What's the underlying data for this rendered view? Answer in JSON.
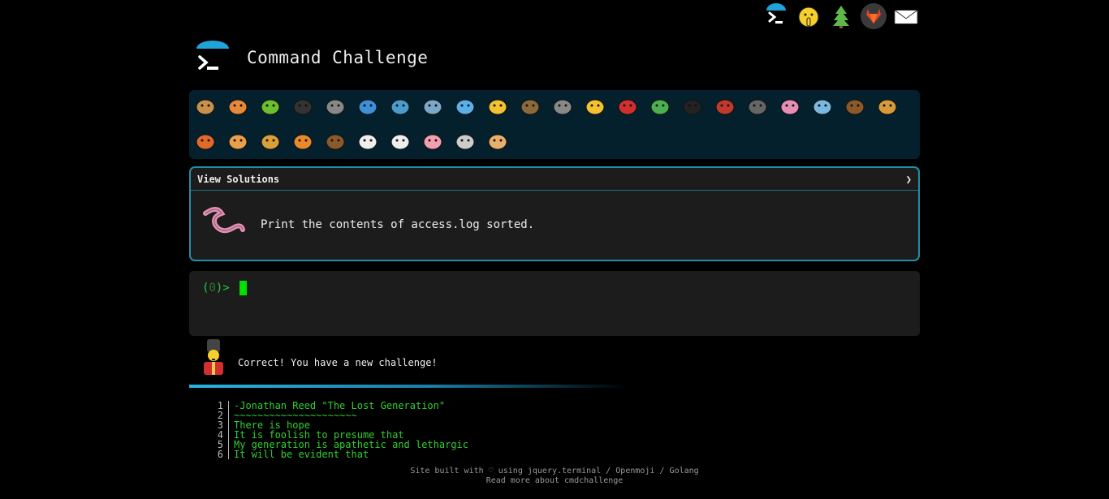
{
  "header": {
    "title": "Command Challenge"
  },
  "top_icons": [
    "terminal-icon",
    "shushing-face-icon",
    "tree-icon",
    "gitlab-icon",
    "envelope-icon"
  ],
  "animals": [
    "snail",
    "butterfly",
    "caterpillar",
    "ant",
    "web",
    "whale",
    "shark",
    "dolphin",
    "fish",
    "tropical-fish",
    "blowfish",
    "wolf",
    "bee",
    "ladybug",
    "cucumber",
    "spider",
    "scorpion",
    "fly",
    "worm",
    "microbe",
    "monkey",
    "dog",
    "fox",
    "cat",
    "lion",
    "tiger",
    "horse",
    "unicorn",
    "cow",
    "pig",
    "mouse",
    "hamster"
  ],
  "challenge": {
    "view_solutions_label": "View Solutions",
    "expand_glyph": "❯",
    "text": "Print the contents of access.log sorted."
  },
  "terminal": {
    "prompt_open": "(",
    "prompt_count": "0",
    "prompt_close": ")>"
  },
  "feedback": {
    "message": "Correct! You have a new challenge!"
  },
  "progress": {
    "fraction": 0.6
  },
  "poem": [
    {
      "n": "1",
      "text": "-Jonathan Reed \"The Lost Generation\""
    },
    {
      "n": "2",
      "text": "~~~~~~~~~~~~~~~~~~~~~"
    },
    {
      "n": "3",
      "text": "There is hope"
    },
    {
      "n": "4",
      "text": "It is foolish to presume that"
    },
    {
      "n": "5",
      "text": "My generation is apathetic and lethargic"
    },
    {
      "n": "6",
      "text": "It will be evident that"
    }
  ],
  "footer": {
    "line1_prefix": "Site built with",
    "heart": "♡",
    "line1_mid": "using",
    "jquery": "jquery.terminal",
    "sep1": "/",
    "openmoji": "Openmoji",
    "sep2": "/",
    "golang": "Golang",
    "line2": "Read more about cmdchallenge"
  },
  "colors": {
    "accent": "#1f8fa8",
    "terminal_green": "#27c93f",
    "panel": "#1c1c1c",
    "animal_bar": "#04202c"
  }
}
